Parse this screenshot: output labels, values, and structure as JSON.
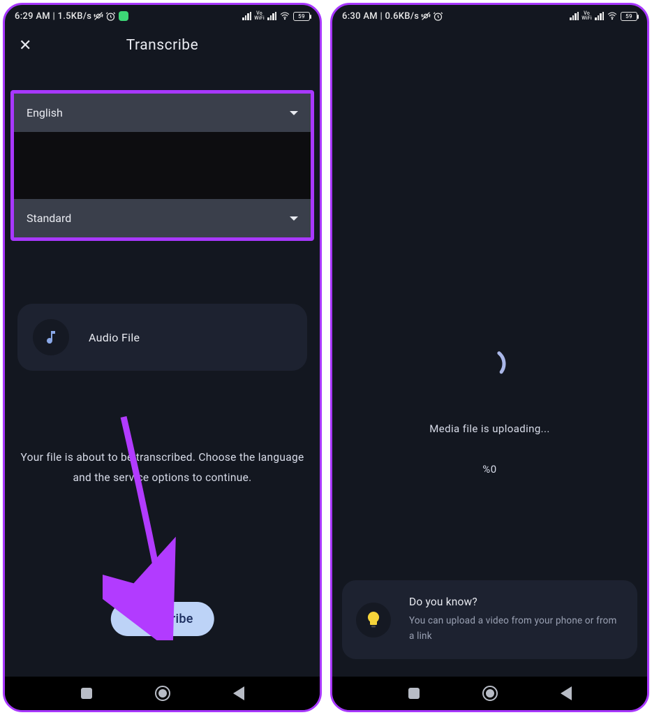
{
  "left": {
    "status": {
      "time_net": "6:29 AM | 1.5KB/s",
      "battery": "59"
    },
    "header": {
      "title": "Transcribe"
    },
    "language": {
      "value": "English"
    },
    "tier": {
      "value": "Standard"
    },
    "audio": {
      "label": "Audio File"
    },
    "instruction": "Your file is about to be transcribed. Choose the language and the service options to continue.",
    "cta": {
      "label": "Transcribe"
    }
  },
  "right": {
    "status": {
      "time_net": "6:30 AM | 0.6KB/s",
      "battery": "59"
    },
    "upload": {
      "message": "Media file is uploading...",
      "percent": "%0"
    },
    "tip": {
      "title": "Do you know?",
      "body": "You can upload a video from your phone or from a link"
    }
  }
}
